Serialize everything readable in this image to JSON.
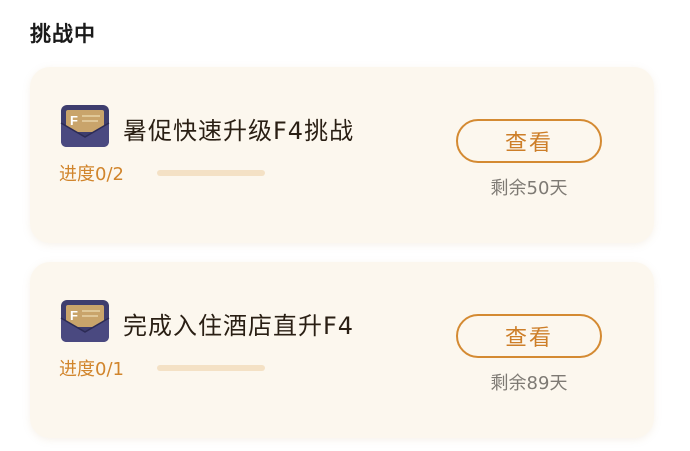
{
  "section": {
    "title": "挑战中"
  },
  "challenges": [
    {
      "title": "暑促快速升级F4挑战",
      "progress_label": "进度0/2",
      "progress": 0,
      "button_label": "查看",
      "days_left": "剩余50天",
      "icon": "envelope-f-icon"
    },
    {
      "title": "完成入住酒店直升F4",
      "progress_label": "进度0/1",
      "progress": 0,
      "button_label": "查看",
      "days_left": "剩余89天",
      "icon": "envelope-f-icon"
    }
  ],
  "colors": {
    "accent": "#d1852c",
    "card_bg": "#fcf7ee",
    "track": "#f4e1c5",
    "badge_dark": "#3b3a6b"
  }
}
